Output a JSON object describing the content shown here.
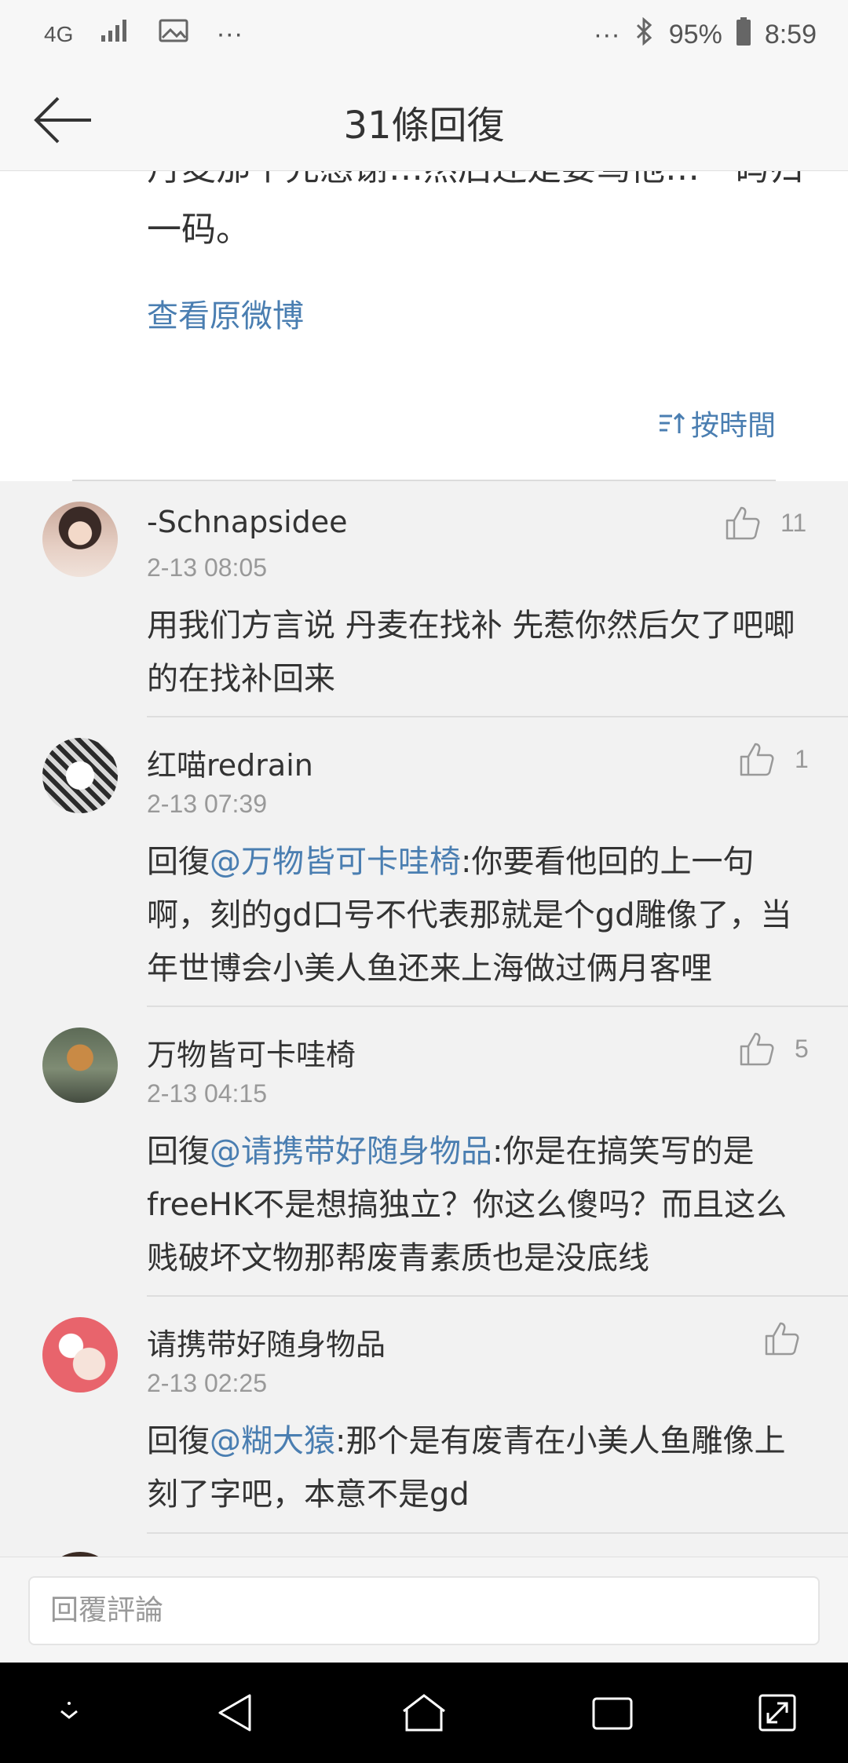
{
  "status_bar": {
    "network": "4G",
    "more_left": "···",
    "more_right": "···",
    "battery": "95%",
    "time": "8:59"
  },
  "header": {
    "title": "31條回復"
  },
  "post": {
    "text": "丹麦那个先感谢…然后还是要骂他…一码归一码。",
    "view_original": "查看原微博",
    "sort_label": "按時間"
  },
  "comments": [
    {
      "name": "-Schnapsidee",
      "time": "2-13 08:05",
      "likes": "11",
      "body_prefix": "",
      "mention": "",
      "body": "用我们方言说 丹麦在找补 先惹你然后欠了吧唧的在找补回来"
    },
    {
      "name": "红喵redrain",
      "time": "2-13 07:39",
      "likes": "1",
      "body_prefix": "回復",
      "mention": "@万物皆可卡哇椅",
      "body": ":你要看他回的上一句啊，刻的gd口号不代表那就是个gd雕像了，当年世博会小美人鱼还来上海做过俩月客哩"
    },
    {
      "name": "万物皆可卡哇椅",
      "time": "2-13 04:15",
      "likes": "5",
      "body_prefix": "回復",
      "mention": "@请携带好随身物品",
      "body": ":你是在搞笑写的是freeHK不是想搞独立？你这么傻吗？而且这么贱破坏文物那帮废青素质也是没底线"
    },
    {
      "name": "请携带好随身物品",
      "time": "2-13 02:25",
      "likes": "",
      "body_prefix": "回復",
      "mention": "@糊大猿",
      "body": ":那个是有废青在小美人鱼雕像上刻了字吧，本意不是gd"
    }
  ],
  "reply_bar": {
    "placeholder": "回覆評論"
  },
  "colors": {
    "link": "#4a7eb1",
    "meta": "#999999",
    "text": "#333333",
    "background": "#f2f2f2"
  }
}
